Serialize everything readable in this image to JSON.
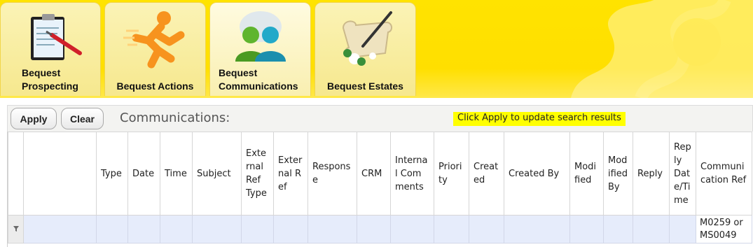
{
  "tabs": [
    {
      "label": "Bequest\nProspecting",
      "icon": "clipboard-icon",
      "active": false
    },
    {
      "label": "Bequest Actions",
      "icon": "running-man-icon",
      "active": false
    },
    {
      "label": "Bequest\nCommunications",
      "icon": "two-people-icon",
      "active": true
    },
    {
      "label": "Bequest Estates",
      "icon": "quill-scroll-icon",
      "active": false
    }
  ],
  "toolbar": {
    "apply_label": "Apply",
    "clear_label": "Clear",
    "section_title": "Communications:",
    "hint": "Click Apply to update search results"
  },
  "grid": {
    "columns": [
      {
        "label": ""
      },
      {
        "label": ""
      },
      {
        "label": "Type"
      },
      {
        "label": "Date"
      },
      {
        "label": "Time"
      },
      {
        "label": "Subject"
      },
      {
        "label": "External Ref Type"
      },
      {
        "label": "External Ref"
      },
      {
        "label": "Response"
      },
      {
        "label": "CRM"
      },
      {
        "label": "Internal Comments"
      },
      {
        "label": "Priority"
      },
      {
        "label": "Created"
      },
      {
        "label": "Created By"
      },
      {
        "label": "Modified"
      },
      {
        "label": "Modified By"
      },
      {
        "label": "Reply"
      },
      {
        "label": "Reply Date/Time"
      },
      {
        "label": "Communication Ref"
      }
    ],
    "filter_values": {
      "communication_ref": "M0259 or MS0049"
    }
  },
  "colors": {
    "header_yellow": "#ffe300",
    "hint_highlight": "#ffff00",
    "filter_row": "#e6ecfb"
  }
}
